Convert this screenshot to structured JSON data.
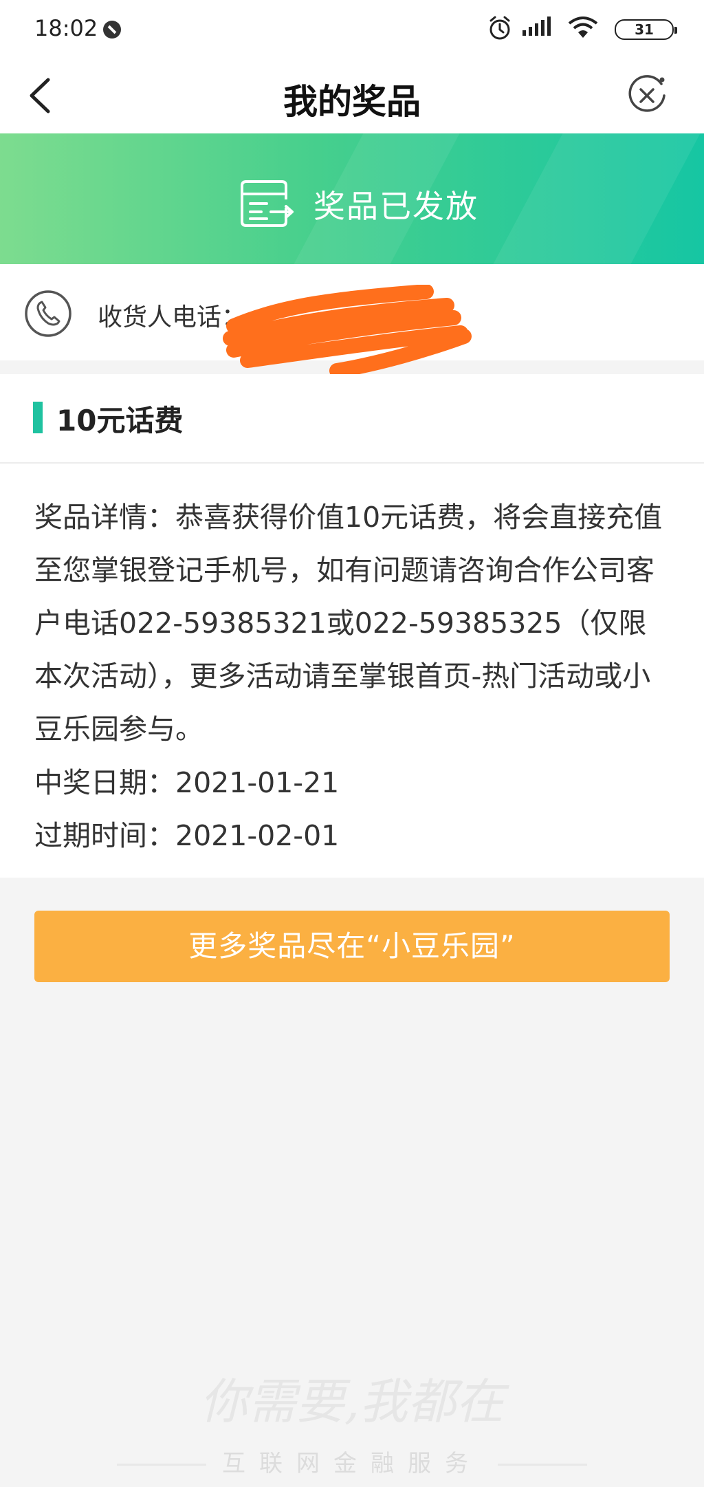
{
  "status_bar": {
    "time": "18:02",
    "battery": "31",
    "icons": [
      "dnd-icon",
      "alarm-icon",
      "signal-icon",
      "wifi-icon",
      "battery-icon"
    ]
  },
  "nav": {
    "title": "我的奖品",
    "back_icon": "chevron-left-icon",
    "close_icon": "close-circle-icon"
  },
  "banner": {
    "status_text": "奖品已发放",
    "icon": "receipt-transfer-icon",
    "colors": {
      "start": "#7ddc8f",
      "end": "#16c6a3"
    }
  },
  "receiver": {
    "label": "收货人电话：",
    "value": "",
    "icon": "phone-icon",
    "redaction_color": "#ff6f1c"
  },
  "prize": {
    "name": "10元话费",
    "accent_color": "#1fc2a0",
    "details": "奖品详情：恭喜获得价值10元话费，将会直接充值至您掌银登记手机号，如有问题请咨询合作公司客户电话022-59385321或022-59385325（仅限本次活动），更多活动请至掌银首页-热门活动或小豆乐园参与。",
    "win_date_label": "中奖日期：",
    "win_date": "2021-01-21",
    "expire_label": "过期时间：",
    "expire_date": "2021-02-01"
  },
  "more_button": {
    "label": "更多奖品尽在“小豆乐园”",
    "color": "#fbb042"
  },
  "footer": {
    "slogan": "你需要,我都在",
    "tagline": "互联网金融服务"
  }
}
